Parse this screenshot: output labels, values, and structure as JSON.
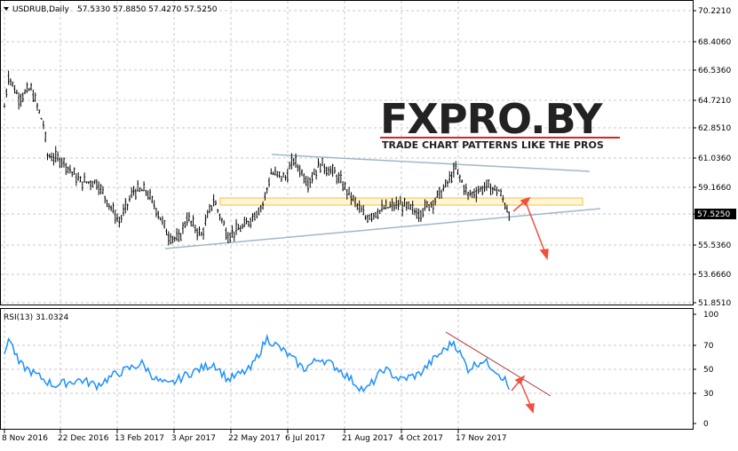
{
  "header": {
    "symbol": "USDRUB,Daily",
    "ohlc": "57.5330 57.8850 57.4270 57.5250"
  },
  "rsi_header": "RSI(13) 31.0324",
  "logo": {
    "text": "FXPRO.BY",
    "tagline": "TRADE CHART PATTERNS LIKE THE PROS"
  },
  "colors": {
    "price": "#000000",
    "rsi": "#1e90ff",
    "trend": "#9fb8c8",
    "zone": "#f5c242",
    "arrow": "#f05040",
    "highlight": "#000000"
  },
  "chart_data": [
    {
      "type": "line",
      "title": "USDRUB,Daily",
      "ylim": [
        51.851,
        70.221
      ],
      "price_ticks": [
        "70.2210",
        "68.4060",
        "66.5360",
        "64.7210",
        "62.8510",
        "61.0360",
        "59.1660",
        "57.5250",
        "55.5360",
        "53.6660",
        "51.8510"
      ],
      "current": "57.5250",
      "x": [
        0,
        2,
        7,
        13,
        19,
        21,
        28,
        37,
        45,
        56,
        63,
        69,
        74,
        80,
        85,
        89,
        96,
        102,
        109,
        117,
        126,
        130,
        137,
        141,
        148,
        154,
        161,
        167,
        176,
        185,
        193,
        202,
        210,
        215,
        220,
        226,
        235,
        241,
        246
      ],
      "values": [
        64.19,
        66.14,
        64.75,
        65.31,
        63.07,
        61.12,
        60.84,
        59.45,
        59.45,
        56.93,
        58.89,
        58.89,
        57.77,
        56.09,
        55.81,
        57.21,
        56.09,
        58.33,
        56.09,
        56.65,
        58.05,
        60.0,
        59.72,
        60.84,
        59.45,
        60.56,
        60.0,
        58.89,
        57.21,
        57.77,
        58.05,
        57.49,
        58.33,
        59.17,
        60.28,
        58.61,
        59.17,
        58.89,
        57.525
      ]
    },
    {
      "type": "line",
      "title": "RSI(13)",
      "ylim": [
        0,
        100
      ],
      "ticks": [
        "100",
        "70",
        "50",
        "30",
        "0"
      ],
      "x": [
        0,
        2,
        7,
        15,
        24,
        37,
        45,
        54,
        67,
        74,
        80,
        89,
        102,
        109,
        120,
        128,
        137,
        146,
        154,
        163,
        172,
        176,
        185,
        193,
        202,
        210,
        219,
        226,
        233,
        239,
        244,
        246
      ],
      "values": [
        60,
        80,
        55,
        45,
        35,
        40,
        35,
        45,
        55,
        40,
        35,
        45,
        55,
        40,
        50,
        78,
        65,
        50,
        60,
        50,
        35,
        30,
        50,
        40,
        45,
        60,
        75,
        50,
        58,
        50,
        40,
        31
      ]
    }
  ],
  "dates": [
    "8 Nov 2016",
    "22 Dec 2016",
    "13 Feb 2017",
    "3 Apr 2017",
    "22 May 2017",
    "6 Jul 2017",
    "21 Aug 2017",
    "4 Oct 2017",
    "17 Nov 2017"
  ]
}
